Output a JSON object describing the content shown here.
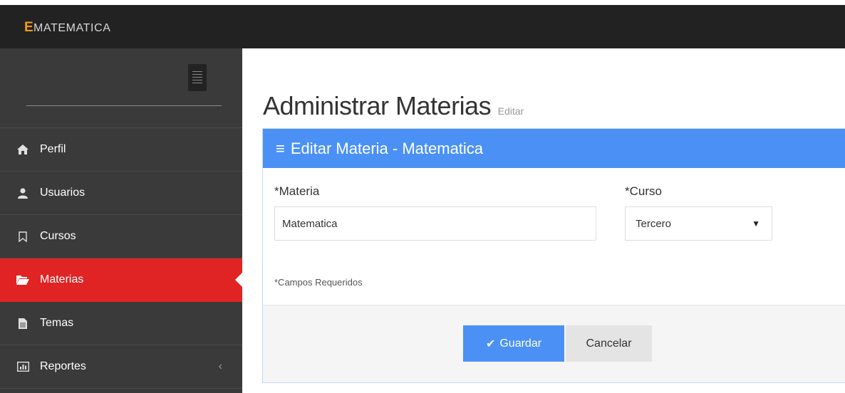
{
  "brand": {
    "first_letter": "E",
    "rest": "MATEMATICA"
  },
  "colors": {
    "topbar": "#222222",
    "sidebar": "#3a3a3a",
    "active": "#e02424",
    "primary": "#4b91f5",
    "brand_accent": "#f39c12"
  },
  "sidebar": {
    "toggle_icon": "menu-icon",
    "items": [
      {
        "label": "Perfil",
        "icon": "home-icon",
        "active": false
      },
      {
        "label": "Usuarios",
        "icon": "user-icon",
        "active": false
      },
      {
        "label": "Cursos",
        "icon": "bookmark-icon",
        "active": false
      },
      {
        "label": "Materias",
        "icon": "folder-open-icon",
        "active": true
      },
      {
        "label": "Temas",
        "icon": "file-icon",
        "active": false
      },
      {
        "label": "Reportes",
        "icon": "bar-chart-icon",
        "active": false,
        "chevron": "‹"
      }
    ]
  },
  "page": {
    "title": "Administrar Materias",
    "subtitle": "Editar"
  },
  "panel": {
    "header_icon": "≡",
    "header_title": "Editar Materia - Matematica",
    "materia_label": "*Materia",
    "materia_value": "Matematica",
    "curso_label": "*Curso",
    "curso_selected": "Tercero",
    "required_note": "*Campos Requeridos",
    "save_label": "Guardar",
    "cancel_label": "Cancelar"
  }
}
